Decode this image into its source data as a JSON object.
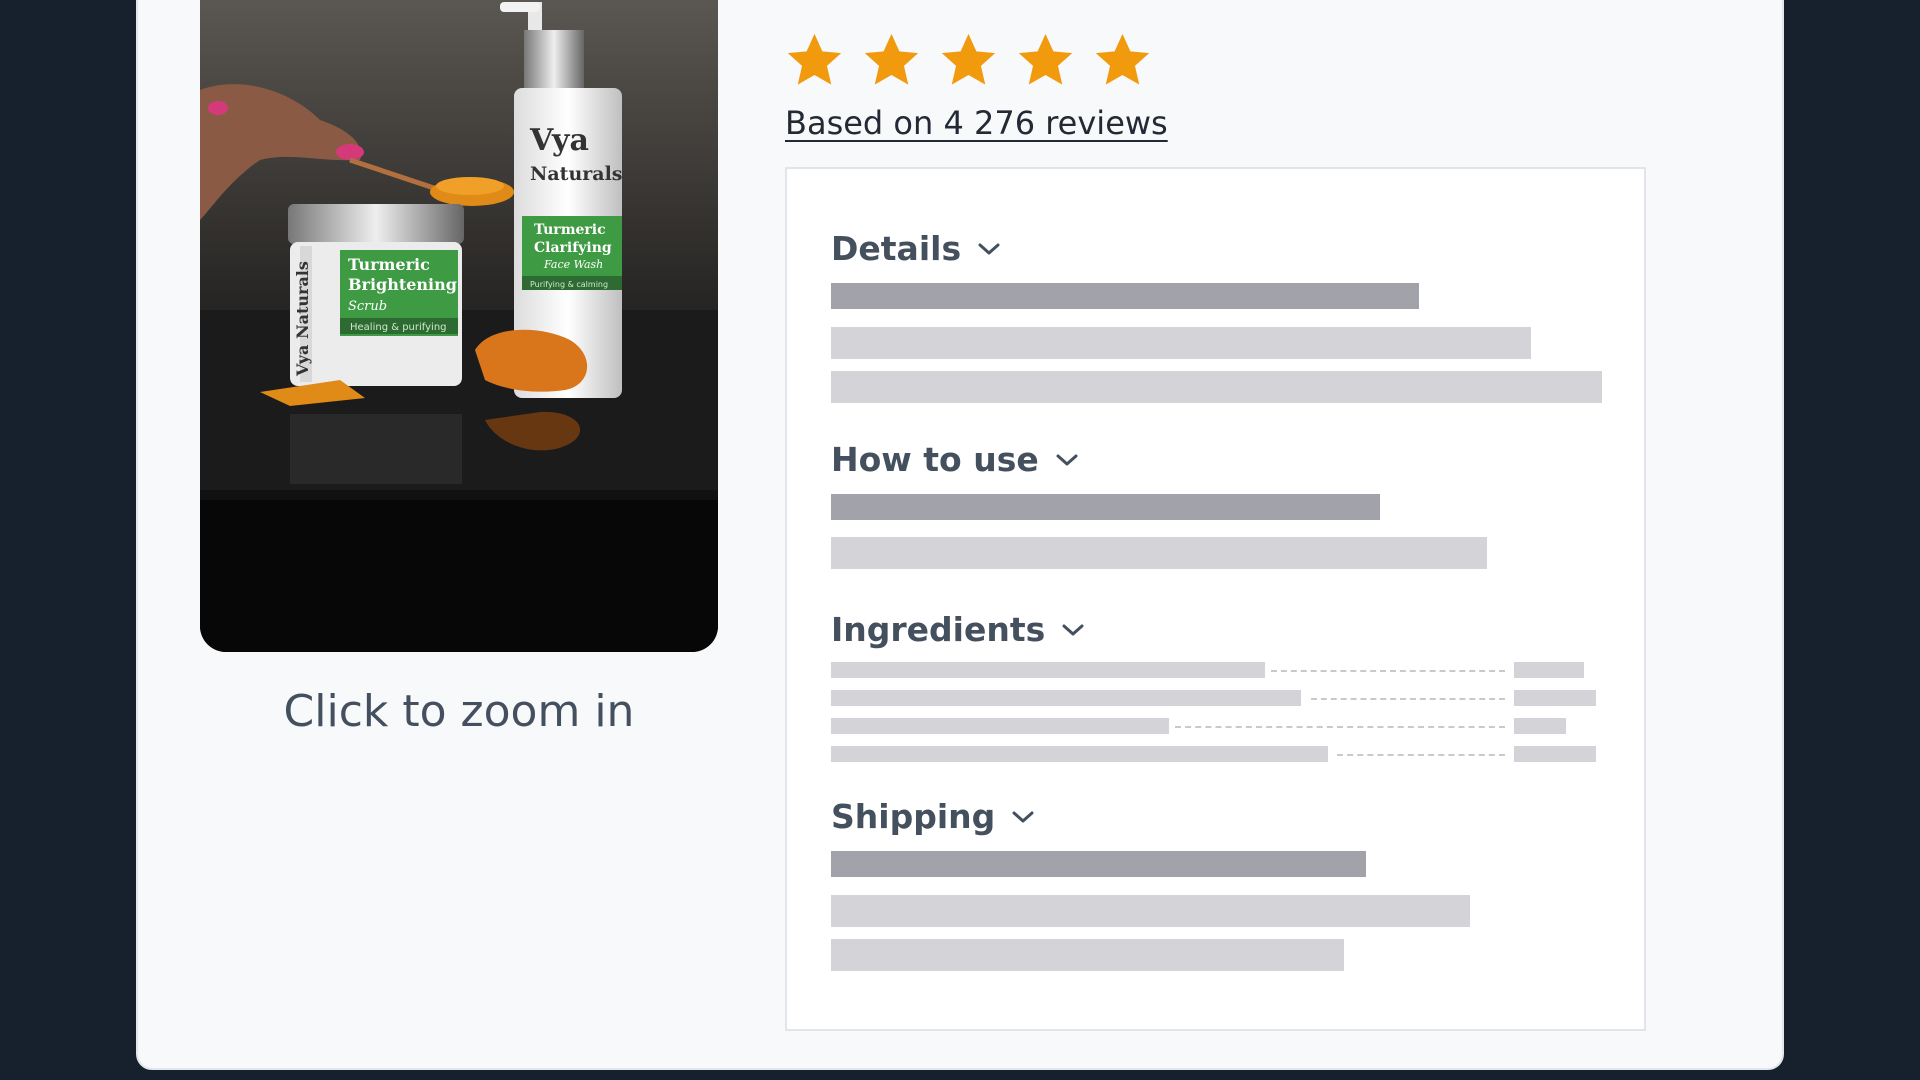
{
  "product": {
    "zoom_caption": "Click to zoom in",
    "image_text": {
      "scrub_brand": "Vya Naturals",
      "scrub_line1": "Turmeric",
      "scrub_line2": "Brightening",
      "scrub_line3": "Scrub",
      "scrub_tag": "Healing & purifying",
      "wash_brand1": "Vya",
      "wash_brand2": "Naturals",
      "wash_line1": "Turmeric",
      "wash_line2": "Clarifying",
      "wash_line3": "Face Wash",
      "wash_tag": "Purifying & calming"
    }
  },
  "rating": {
    "stars": 5,
    "max_stars": 5,
    "star_color": "#f29a0e",
    "reviews_label": "Based on 4 276 reviews"
  },
  "accordion": {
    "sections": [
      {
        "title": "Details",
        "icon": "chevron-down-icon"
      },
      {
        "title": "How to use",
        "icon": "chevron-down-icon"
      },
      {
        "title": "Ingredients",
        "icon": "chevron-down-icon"
      },
      {
        "title": "Shipping",
        "icon": "chevron-down-icon"
      }
    ]
  },
  "colors": {
    "page_background": "#17202d",
    "card_background": "#f8f9fb",
    "skeleton_dark": "#a2a2aa",
    "skeleton_light": "#d3d3d8"
  }
}
